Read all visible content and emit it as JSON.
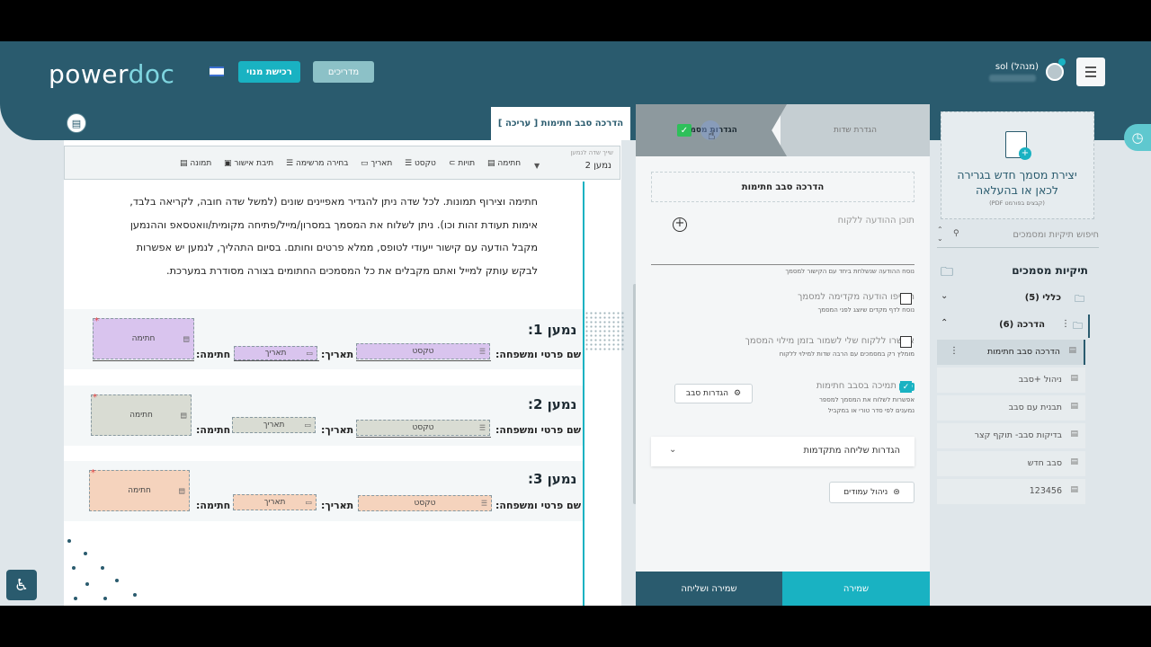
{
  "header": {
    "logo_power": "power",
    "logo_doc": "doc",
    "buy_plan_label": "רכישת מנוי",
    "guides_label": "מדריכים",
    "user_name": "sol (מנהל)"
  },
  "document": {
    "tab_title": "הדרכה סבב חתימות [ עריכה ]",
    "signer_select_label": "שייך שדה לנמען",
    "signer_select_value": "נמען 2",
    "toolbar": [
      {
        "label": "חתימה",
        "icon": "signature-icon"
      },
      {
        "label": "תויות",
        "icon": "tag-icon"
      },
      {
        "label": "טקסט",
        "icon": "text-icon"
      },
      {
        "label": "תאריך",
        "icon": "calendar-icon"
      },
      {
        "label": "בחירה מרשימה",
        "icon": "list-icon"
      },
      {
        "label": "תיבת אישור",
        "icon": "checkbox-icon"
      },
      {
        "label": "תמונה",
        "icon": "image-icon"
      }
    ],
    "body_text": "חתימה וצירוף תמונות. לכל שדה ניתן להגדיר מאפיינים שונים (למשל שדה חובה, לקריאה בלבד, אימות תעודת זהות וכו). ניתן לשלוח את המסמך במסרון/מייל/פתיחה מקומית/וואטסאפ וההנמען מקבל הודעה עם קישור ייעודי לטופס, ממלא פרטים וחותם. בסיום התהליך, לנמען יש אפשרות לבקש עותק למייל ואתם מקבלים את כל המסמכים החתומים בצורה מסודרת במערכת.",
    "signers": [
      {
        "title": "נמען 1:",
        "name_label": "שם פרטי ומשפחה:",
        "date_label": "תאריך:",
        "sig_label": "חתימה:",
        "text_field": "טקסט",
        "date_field": "תאריך",
        "sig_field": "חתימה",
        "color": "#d9c4ee"
      },
      {
        "title": "נמען 2:",
        "name_label": "שם פרטי ומשפחה:",
        "date_label": "תאריך:",
        "sig_label": "חתימה:",
        "text_field": "טקסט",
        "date_field": "תאריך",
        "sig_field": "חתימה",
        "color": "#d9dcd3"
      },
      {
        "title": "נמען 3:",
        "name_label": "שם פרטי ומשפחה:",
        "date_label": "תאריך:",
        "sig_label": "חתימה:",
        "text_field": "טקסט",
        "date_field": "תאריך",
        "sig_field": "חתימה",
        "color": "#f5d3bd"
      }
    ]
  },
  "settings": {
    "tab_fields": "הגדרת שדות",
    "tab_doc_settings": "הגדרות מסמך",
    "doc_title": "הדרכה סבב חתימות",
    "message_placeholder": "תוכן ההודעה ללקוח",
    "message_hint": "נוסח ההודעה שנשלחת ביחד עם הקישור למסמך",
    "options": [
      {
        "title": "הוסיפו הודעה מקדימה למסמך",
        "sub": "נוסח לדף מקדים שיוצג לפני המסמך",
        "checked": false
      },
      {
        "title": "אפשרו ללקוח שלי לשמור בזמן מילוי המסמך",
        "sub": "מומלץ רק במסמכים עם הרבה שדות למילוי ללקוח",
        "checked": false
      },
      {
        "title": "תמיכה בסבב חתימות",
        "sub1": "אפשרות לשלוח את המסמך למספר",
        "sub2": "נמענים לפי סדר טורי או במקביל",
        "badge": "New",
        "checked": true
      }
    ],
    "bg_settings_label": "הגדרות סבב",
    "advanced_label": "הגדרות שליחה מתקדמות",
    "pages_label": "ניהול עמודים",
    "save_send_label": "שמירה ושליחה",
    "save_label": "שמירה"
  },
  "sidebar": {
    "create_text": "יצירת מסמך חדש בגרירה לכאן או בהעלאה",
    "create_sub": "(קבצים בפורמט PDF)",
    "search_placeholder": "חיפוש תיקיות ומסמכים",
    "folders_title": "תיקיות מסמכים",
    "folders": [
      {
        "name": "כללי (5)",
        "expanded": false
      },
      {
        "name": "הדרכה (6)",
        "expanded": true
      }
    ],
    "docs": [
      {
        "name": "הדרכה סבב חתימות",
        "active": true
      },
      {
        "name": "ניהול +סבב",
        "active": false
      },
      {
        "name": "תבנית עם סבב",
        "active": false
      },
      {
        "name": "בדיקות סבב- תוקף קצר",
        "active": false
      },
      {
        "name": "סבב חדש",
        "active": false
      },
      {
        "name": "123456",
        "active": false
      }
    ]
  }
}
